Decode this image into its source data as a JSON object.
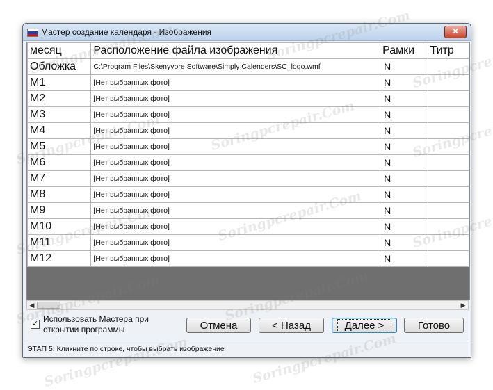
{
  "window": {
    "title": "Мастер создание календаря - Изображения",
    "close_symbol": "✕"
  },
  "table": {
    "columns": [
      "месяц",
      "Расположение файла изображения",
      "Рамки",
      "Титр"
    ],
    "rows": [
      {
        "month": "Обложка",
        "file": "C:\\Program Files\\Skenyvore Software\\Simply Calenders\\SC_logo.wmf",
        "frames": "N",
        "title": ""
      },
      {
        "month": "M1",
        "file": "[Нет выбранных фото]",
        "frames": "N",
        "title": ""
      },
      {
        "month": "M2",
        "file": "[Нет выбранных фото]",
        "frames": "N",
        "title": ""
      },
      {
        "month": "M3",
        "file": "[Нет выбранных фото]",
        "frames": "N",
        "title": ""
      },
      {
        "month": "M4",
        "file": "[Нет выбранных фото]",
        "frames": "N",
        "title": ""
      },
      {
        "month": "M5",
        "file": "[Нет выбранных фото]",
        "frames": "N",
        "title": ""
      },
      {
        "month": "M6",
        "file": "[Нет выбранных фото]",
        "frames": "N",
        "title": ""
      },
      {
        "month": "M7",
        "file": "[Нет выбранных фото]",
        "frames": "N",
        "title": ""
      },
      {
        "month": "M8",
        "file": "[Нет выбранных фото]",
        "frames": "N",
        "title": ""
      },
      {
        "month": "M9",
        "file": "[Нет выбранных фото]",
        "frames": "N",
        "title": ""
      },
      {
        "month": "M10",
        "file": "[Нет выбранных фото]",
        "frames": "N",
        "title": ""
      },
      {
        "month": "M11",
        "file": "[Нет выбранных фото]",
        "frames": "N",
        "title": ""
      },
      {
        "month": "M12",
        "file": "[Нет выбранных фото]",
        "frames": "N",
        "title": ""
      }
    ]
  },
  "options": {
    "use_wizard_line1": "Использовать Мастера при",
    "use_wizard_line2": "открытии программы",
    "use_wizard_checked": true
  },
  "buttons": {
    "cancel": "Отмена",
    "back": "< Назад",
    "next": "Далее >",
    "finish": "Готово"
  },
  "status": "ЭТАП 5: Кликните по строке, чтобы выбрать изображение",
  "watermark": "Soringpcrepair.Com",
  "colors": {
    "titlebar": "#bcd2ea",
    "grid_empty": "#6f6f6f",
    "close_button": "#c9452d"
  }
}
